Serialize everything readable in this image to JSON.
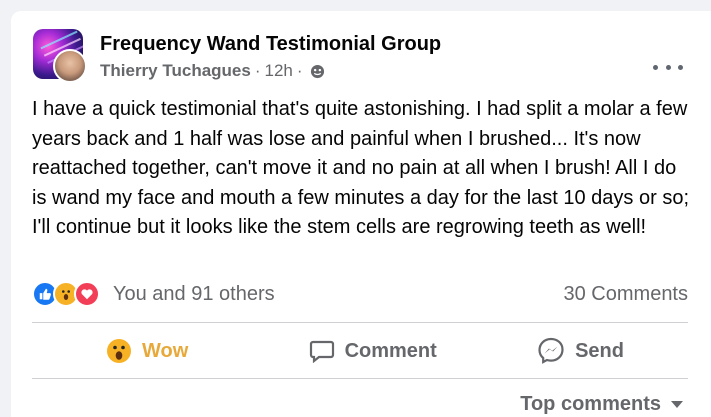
{
  "post": {
    "group_name": "Frequency Wand Testimonial Group",
    "author": "Thierry Tuchagues",
    "separator_1": "·",
    "time": "12h",
    "separator_2": "·",
    "privacy_icon": "globe-icon",
    "text": "I have a quick testimonial that's quite astonishing. I had split a molar a few years back and 1 half was lose and painful when I brushed... It's now reattached together, can't move it and no pain at all when I brush! All I do is wand my face and mouth a few minutes a day for the last 10 days or so; I'll continue but it looks like the stem cells are regrowing teeth as well!"
  },
  "reactions": {
    "icons": [
      "like-icon",
      "wow-icon",
      "love-icon"
    ],
    "summary": "You and 91 others",
    "comments": "30 Comments"
  },
  "actions": {
    "wow_label": "Wow",
    "comment_label": "Comment",
    "send_label": "Send"
  },
  "comments_filter": {
    "label": "Top comments"
  },
  "colors": {
    "like": "#1877f2",
    "wow": "#f7b125",
    "love": "#f33e58",
    "wow_text": "#e8a93b",
    "secondary_text": "#65676b"
  }
}
